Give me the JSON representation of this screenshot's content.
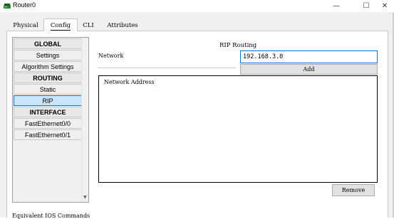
{
  "window": {
    "title": "Router0",
    "minimize_glyph": "—",
    "maximize_glyph": "☐",
    "close_glyph": "✕",
    "icon": "router-icon"
  },
  "tabs": [
    {
      "label": "Physical",
      "active": false
    },
    {
      "label": "Config",
      "active": true
    },
    {
      "label": "CLI",
      "active": false
    },
    {
      "label": "Attributes",
      "active": false
    }
  ],
  "nav": {
    "items": [
      {
        "label": "GLOBAL",
        "type": "header"
      },
      {
        "label": "Settings",
        "type": "item"
      },
      {
        "label": "Algorithm Settings",
        "type": "item"
      },
      {
        "label": "ROUTING",
        "type": "header"
      },
      {
        "label": "Static",
        "type": "item"
      },
      {
        "label": "RIP",
        "type": "item",
        "selected": true
      },
      {
        "label": "INTERFACE",
        "type": "header"
      },
      {
        "label": "FastEthernet0/0",
        "type": "item"
      },
      {
        "label": "FastEthernet0/1",
        "type": "item"
      }
    ]
  },
  "rip": {
    "title": "RIP Routing",
    "network_label": "Network",
    "network_value": "192.168.3.0",
    "add_label": "Add",
    "list_header": "Network Address",
    "addresses": [],
    "remove_label": "Remove"
  },
  "footer": {
    "ios_label": "Equivalent IOS Commands"
  },
  "colors": {
    "accent": "#0078d7",
    "selected_bg": "#cce4f7",
    "button_bg": "#e1e1e1"
  }
}
